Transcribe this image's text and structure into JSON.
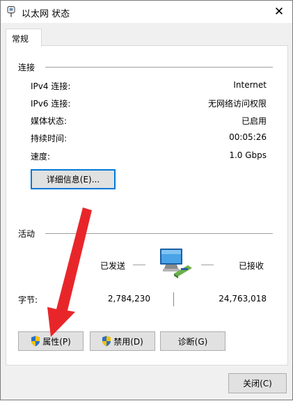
{
  "window": {
    "title": "以太网 状态",
    "close_glyph": "✕"
  },
  "tabs": [
    {
      "label": "常规"
    }
  ],
  "connection": {
    "group_label": "连接",
    "rows": [
      {
        "label": "IPv4 连接:",
        "value": "Internet"
      },
      {
        "label": "IPv6 连接:",
        "value": "无网络访问权限"
      },
      {
        "label": "媒体状态:",
        "value": "已启用"
      },
      {
        "label": "持续时间:",
        "value": "00:05:26"
      },
      {
        "label": "速度:",
        "value": "1.0 Gbps"
      }
    ],
    "details_button": "详细信息(E)..."
  },
  "activity": {
    "group_label": "活动",
    "sent_label": "已发送",
    "received_label": "已接收",
    "bytes_label": "字节:",
    "bytes_sent": "2,784,230",
    "bytes_received": "24,763,018"
  },
  "buttons": {
    "properties": "属性(P)",
    "disable": "禁用(D)",
    "diagnose": "诊断(G)",
    "close": "关闭(C)"
  },
  "colors": {
    "accent": "#0078d7",
    "arrow": "#e8262a"
  }
}
